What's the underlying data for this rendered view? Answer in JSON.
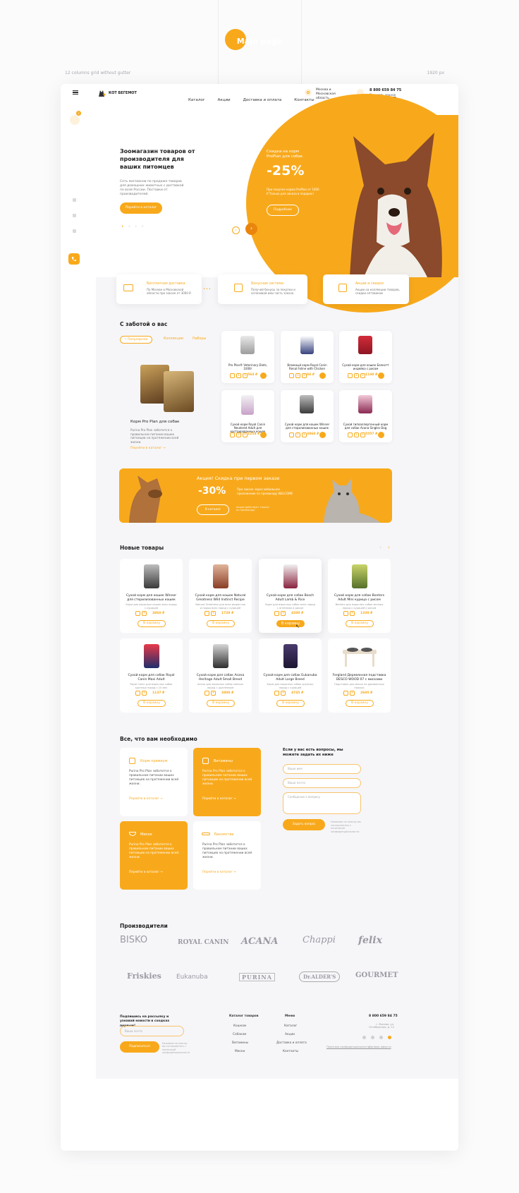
{
  "page": {
    "title": "Main page",
    "grid_note": "12 columns grid without gutter",
    "width_note": "1920 px"
  },
  "header": {
    "brand": "КОТ БЕГЕМОТ",
    "nav": [
      "Каталог",
      "Акции",
      "Доставка и оплата",
      "Контакты"
    ],
    "location": "Москва и Московская область",
    "phone": "8 800 659 84 75",
    "callback": "Заказать звонок",
    "cart_count": "2"
  },
  "hero": {
    "title": "Зоомагазин товаров от производителя для ваших питомцев",
    "text": "Сеть магазинов по продаже товаров для домашних животных с доставкой по всей России. Поставки от производителей.",
    "button": "Перейти в каталог",
    "promo_title": "Скидка на корм ProPlan для собак",
    "promo_value": "-25%",
    "promo_text": "При покупке корма ProPlan от 1000 ₽ Только для заказа в подарок!",
    "promo_button": "Подробнее"
  },
  "features": [
    {
      "title": "Бесплатная доставка",
      "text": "По Москве и Московской области при заказе от 3000 ₽"
    },
    {
      "title": "Бонусная система",
      "text": "Получай бонусы за покупки и оплачивай ими часть заказа"
    },
    {
      "title": "Акции и скидки",
      "text": "Акции на коллекции товаров, скидки оптовикам"
    }
  ],
  "care": {
    "title": "С заботой о вас",
    "tabs": [
      "• Популярное",
      "Коллекции",
      "Наборы"
    ],
    "featured_title": "Корм Pro Plan для собак",
    "featured_text": "Purina Pro Plan заботится о правильном питании ваших питомцев на протяжении всей жизни.",
    "featured_link": "Перейти в каталог →",
    "products": [
      {
        "name": "Pro Plan® Veterinary Diets, 1000г",
        "price": "564 ₽"
      },
      {
        "name": "Влажный корм Royal Canin Renal Feline with Chicken",
        "price": "84 ₽"
      },
      {
        "name": "Сухой корм для кошек Белкотт индейка с рисом",
        "price": "1140 ₽"
      },
      {
        "name": "Сухой корм Royal Canin Neutered Adult для кастрированных кошек",
        "price": "1254 ₽"
      },
      {
        "name": "Сухой корм для кошек Winner для стерилизованных кошек",
        "price": "3860 ₽"
      },
      {
        "name": "Сухой гипоаллергенный корм для собак Acana Singles Dog",
        "price": "5557 ₽"
      }
    ],
    "qty": "1"
  },
  "banner": {
    "title": "Акция! Скидка при первом заказе",
    "value": "-30%",
    "text": "При заказе через мобильное приложение по промокоду WELCOME",
    "button": "В каталог",
    "note": "Акция действует только по промокоду"
  },
  "new_products": {
    "title": "Новые товары",
    "cart_button": "В корзину",
    "items": [
      {
        "name": "Сухой корм для кошек Winner для стерилизованных кошек",
        "desc": "Корм для взрослых кошек всех пород с курицей",
        "price": "3860 ₽"
      },
      {
        "name": "Сухой корм для кошек Natural Greatness Wild Instinct Recipe",
        "desc": "Natural Greatness для всех возрастов и пород всех пород с курицей",
        "price": "1729 ₽"
      },
      {
        "name": "Сухой корм для собак Bosch Adult Lamb & Rice",
        "desc": "Корм для взрослых собак всех пород с ягнёнком и рисом",
        "price": "4200 ₽"
      },
      {
        "name": "Сухой корм для собак Bonters Adult Mini курица с рисом",
        "desc": "Bonters для взрослых собак мелких пород с курицей и рисом",
        "price": "1330 ₽"
      },
      {
        "name": "Сухой корм для собак Royal Canin Maxi Adult",
        "desc": "Royal Canin для взрослых собак крупных пород с 15 мес",
        "price": "1137 ₽"
      },
      {
        "name": "Сухой корм для собак Acana Heritage Adult Small Breed",
        "desc": "Acana для взрослых собак мелких пород с цыплёнком",
        "price": "3800 ₽"
      },
      {
        "name": "Сухой корм для собак Eukanuba Adult Large Breed",
        "desc": "Корм для взрослых собак крупных пород с курицей",
        "price": "4745 ₽"
      },
      {
        "name": "Fergland Деревянная подставка DESCO WOOD 07 с мисками",
        "desc": "Подставка для мисок на деревянных ножках",
        "price": "2695 ₽"
      }
    ]
  },
  "needs": {
    "title": "Все, что вам необходимо",
    "cards": [
      {
        "title": "Корм премиум",
        "text": "Purina Pro Plan заботится о правильном питании ваших питомцев на протяжении всей жизни.",
        "link": "Перейти в каталог →"
      },
      {
        "title": "Витамины",
        "text": "Purina Pro Plan заботится о правильном питании ваших питомцев на протяжении всей жизни.",
        "link": "Перейти в каталог →"
      },
      {
        "title": "Миски",
        "text": "Purina Pro Plan заботится о правильном питании ваших питомцев на протяжении всей жизни.",
        "link": "Перейти в каталог →"
      },
      {
        "title": "Лакомства",
        "text": "Purina Pro Plan заботится о правильном питании ваших питомцев на протяжении всей жизни.",
        "link": "Перейти в каталог →"
      }
    ],
    "form_title": "Если у вас есть вопросы, мы можете задать их ниже",
    "placeholders": [
      "Ваше имя",
      "Ваша почта",
      "Сообщение к вопросу"
    ],
    "submit": "Задать вопрос",
    "consent": "Нажимая на кнопку вы соглашаетесь с политикой конфиденциальности"
  },
  "brands": {
    "title": "Производители",
    "list": [
      "BISKO",
      "ROYAL CANIN",
      "ACANA",
      "Chappi",
      "felix",
      "Friskies",
      "Eukanuba",
      "PURINA",
      "Dr.ALDER'S",
      "GOURMET"
    ]
  },
  "footer": {
    "subscribe_title": "Подпишись на рассылку и узнавай новости в сходках первым!",
    "email_placeholder": "Ваша почта",
    "subscribe_button": "Подписаться",
    "consent": "Нажимая на кнопку вы соглашаетесь с политикой конфиденциальности",
    "catalog_title": "Каталог товаров",
    "catalog": [
      "Кошкам",
      "Собакам",
      "Витамины",
      "Миски"
    ],
    "menu_title": "Меню",
    "menu": [
      "Каталог",
      "Акции",
      "Доставка и оплата",
      "Контакты"
    ],
    "phone": "8 800 659 84 75",
    "address": "г. Москва, ул. Октябрьская, д. 12",
    "policy": "Политика конфиденциальности",
    "offer": "Договор оферты"
  },
  "colors": {
    "accent": "#f8a91b",
    "bg": "#f6f6f9"
  }
}
